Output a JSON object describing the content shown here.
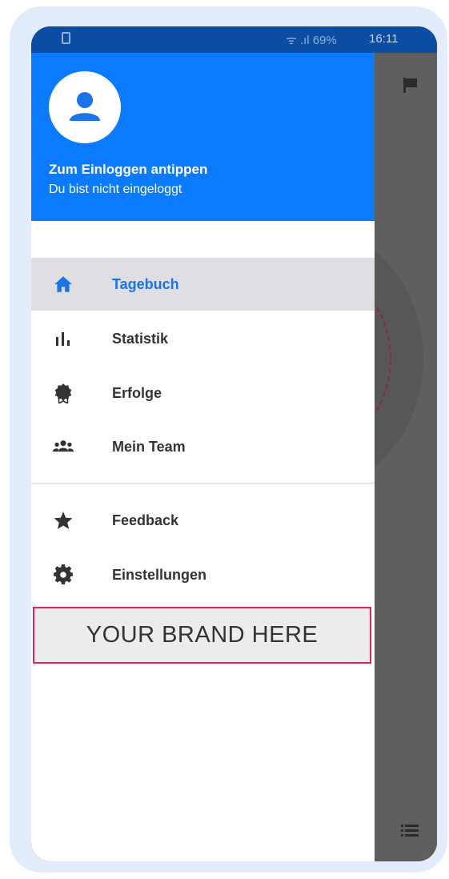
{
  "status_bar": {
    "signal": "69%",
    "time": "16:11"
  },
  "drawer": {
    "header": {
      "title": "Zum Einloggen antippen",
      "subtitle": "Du bist nicht eingeloggt"
    },
    "items": [
      {
        "label": "Tagebuch",
        "icon": "home-icon",
        "active": true
      },
      {
        "label": "Statistik",
        "icon": "bar-chart-icon",
        "active": false
      },
      {
        "label": "Erfolge",
        "icon": "badge-icon",
        "active": false
      },
      {
        "label": "Mein Team",
        "icon": "team-icon",
        "active": false
      },
      {
        "label": "Feedback",
        "icon": "star-icon",
        "active": false
      },
      {
        "label": "Einstellungen",
        "icon": "gear-icon",
        "active": false
      }
    ],
    "brand": "YOUR BRAND HERE"
  },
  "colors": {
    "header": "#0a7bff",
    "active_label": "#1a73e8",
    "brand_border": "#e2245a"
  }
}
